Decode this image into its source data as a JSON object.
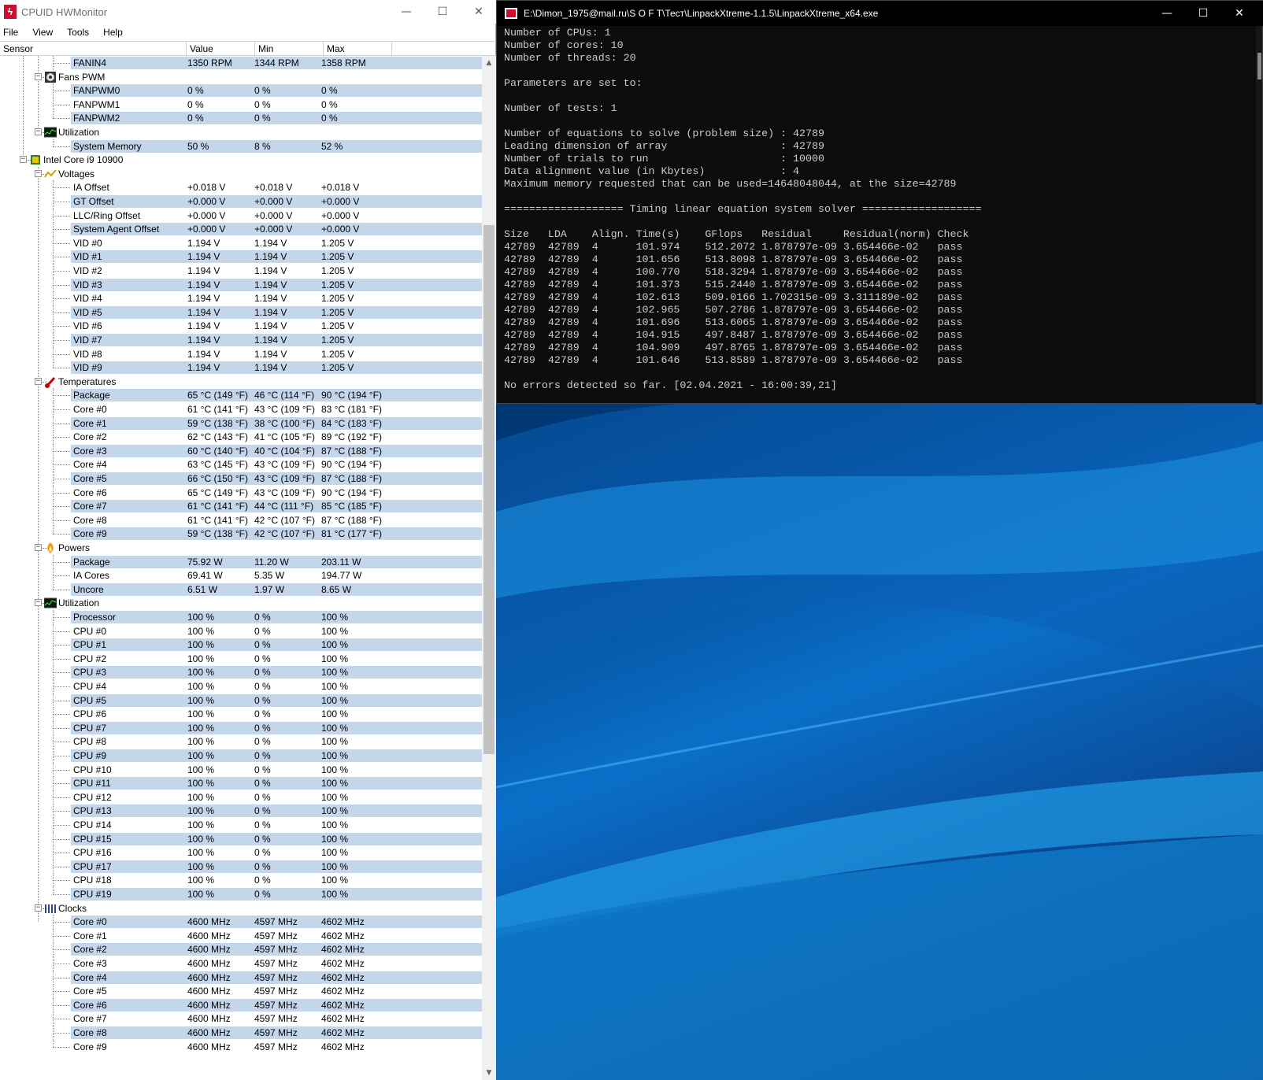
{
  "hwmonitor": {
    "title": "CPUID HWMonitor",
    "menu": [
      "File",
      "View",
      "Tools",
      "Help"
    ],
    "columns": [
      "Sensor",
      "Value",
      "Min",
      "Max"
    ],
    "rows": [
      {
        "label": "FANIN4",
        "value": "1350 RPM",
        "min": "1344 RPM",
        "max": "1358 RPM",
        "level": 3,
        "kind": "leaf"
      },
      {
        "label": "Fans PWM",
        "level": 2,
        "kind": "group",
        "icon": "fan-icon"
      },
      {
        "label": "FANPWM0",
        "value": "0 %",
        "min": "0 %",
        "max": "0 %",
        "level": 3,
        "kind": "leaf"
      },
      {
        "label": "FANPWM1",
        "value": "0 %",
        "min": "0 %",
        "max": "0 %",
        "level": 3,
        "kind": "leaf"
      },
      {
        "label": "FANPWM2",
        "value": "0 %",
        "min": "0 %",
        "max": "0 %",
        "level": 3,
        "kind": "leaf",
        "last": true
      },
      {
        "label": "Utilization",
        "level": 2,
        "kind": "group",
        "icon": "utilization-icon",
        "last": true
      },
      {
        "label": "System Memory",
        "value": "50 %",
        "min": "8 %",
        "max": "52 %",
        "level": 3,
        "kind": "leaf",
        "last": true
      },
      {
        "label": "Intel Core i9 10900",
        "level": 1,
        "kind": "group",
        "icon": "cpu-chip-icon"
      },
      {
        "label": "Voltages",
        "level": 2,
        "kind": "group",
        "icon": "voltage-icon"
      },
      {
        "label": "IA Offset",
        "value": "+0.018 V",
        "min": "+0.018 V",
        "max": "+0.018 V",
        "level": 3,
        "kind": "leaf"
      },
      {
        "label": "GT Offset",
        "value": "+0.000 V",
        "min": "+0.000 V",
        "max": "+0.000 V",
        "level": 3,
        "kind": "leaf"
      },
      {
        "label": "LLC/Ring Offset",
        "value": "+0.000 V",
        "min": "+0.000 V",
        "max": "+0.000 V",
        "level": 3,
        "kind": "leaf"
      },
      {
        "label": "System Agent Offset",
        "value": "+0.000 V",
        "min": "+0.000 V",
        "max": "+0.000 V",
        "level": 3,
        "kind": "leaf"
      },
      {
        "label": "VID #0",
        "value": "1.194 V",
        "min": "1.194 V",
        "max": "1.205 V",
        "level": 3,
        "kind": "leaf"
      },
      {
        "label": "VID #1",
        "value": "1.194 V",
        "min": "1.194 V",
        "max": "1.205 V",
        "level": 3,
        "kind": "leaf"
      },
      {
        "label": "VID #2",
        "value": "1.194 V",
        "min": "1.194 V",
        "max": "1.205 V",
        "level": 3,
        "kind": "leaf"
      },
      {
        "label": "VID #3",
        "value": "1.194 V",
        "min": "1.194 V",
        "max": "1.205 V",
        "level": 3,
        "kind": "leaf"
      },
      {
        "label": "VID #4",
        "value": "1.194 V",
        "min": "1.194 V",
        "max": "1.205 V",
        "level": 3,
        "kind": "leaf"
      },
      {
        "label": "VID #5",
        "value": "1.194 V",
        "min": "1.194 V",
        "max": "1.205 V",
        "level": 3,
        "kind": "leaf"
      },
      {
        "label": "VID #6",
        "value": "1.194 V",
        "min": "1.194 V",
        "max": "1.205 V",
        "level": 3,
        "kind": "leaf"
      },
      {
        "label": "VID #7",
        "value": "1.194 V",
        "min": "1.194 V",
        "max": "1.205 V",
        "level": 3,
        "kind": "leaf"
      },
      {
        "label": "VID #8",
        "value": "1.194 V",
        "min": "1.194 V",
        "max": "1.205 V",
        "level": 3,
        "kind": "leaf"
      },
      {
        "label": "VID #9",
        "value": "1.194 V",
        "min": "1.194 V",
        "max": "1.205 V",
        "level": 3,
        "kind": "leaf",
        "last": true
      },
      {
        "label": "Temperatures",
        "level": 2,
        "kind": "group",
        "icon": "thermometer-icon"
      },
      {
        "label": "Package",
        "value": "65 °C  (149 °F)",
        "min": "46 °C  (114 °F)",
        "max": "90 °C  (194 °F)",
        "level": 3,
        "kind": "leaf"
      },
      {
        "label": "Core #0",
        "value": "61 °C  (141 °F)",
        "min": "43 °C  (109 °F)",
        "max": "83 °C  (181 °F)",
        "level": 3,
        "kind": "leaf"
      },
      {
        "label": "Core #1",
        "value": "59 °C  (138 °F)",
        "min": "38 °C  (100 °F)",
        "max": "84 °C  (183 °F)",
        "level": 3,
        "kind": "leaf"
      },
      {
        "label": "Core #2",
        "value": "62 °C  (143 °F)",
        "min": "41 °C  (105 °F)",
        "max": "89 °C  (192 °F)",
        "level": 3,
        "kind": "leaf"
      },
      {
        "label": "Core #3",
        "value": "60 °C  (140 °F)",
        "min": "40 °C  (104 °F)",
        "max": "87 °C  (188 °F)",
        "level": 3,
        "kind": "leaf"
      },
      {
        "label": "Core #4",
        "value": "63 °C  (145 °F)",
        "min": "43 °C  (109 °F)",
        "max": "90 °C  (194 °F)",
        "level": 3,
        "kind": "leaf"
      },
      {
        "label": "Core #5",
        "value": "66 °C  (150 °F)",
        "min": "43 °C  (109 °F)",
        "max": "87 °C  (188 °F)",
        "level": 3,
        "kind": "leaf"
      },
      {
        "label": "Core #6",
        "value": "65 °C  (149 °F)",
        "min": "43 °C  (109 °F)",
        "max": "90 °C  (194 °F)",
        "level": 3,
        "kind": "leaf"
      },
      {
        "label": "Core #7",
        "value": "61 °C  (141 °F)",
        "min": "44 °C  (111 °F)",
        "max": "85 °C  (185 °F)",
        "level": 3,
        "kind": "leaf"
      },
      {
        "label": "Core #8",
        "value": "61 °C  (141 °F)",
        "min": "42 °C  (107 °F)",
        "max": "87 °C  (188 °F)",
        "level": 3,
        "kind": "leaf"
      },
      {
        "label": "Core #9",
        "value": "59 °C  (138 °F)",
        "min": "42 °C  (107 °F)",
        "max": "81 °C  (177 °F)",
        "level": 3,
        "kind": "leaf",
        "last": true
      },
      {
        "label": "Powers",
        "level": 2,
        "kind": "group",
        "icon": "power-icon"
      },
      {
        "label": "Package",
        "value": "75.92 W",
        "min": "11.20 W",
        "max": "203.11 W",
        "level": 3,
        "kind": "leaf"
      },
      {
        "label": "IA Cores",
        "value": "69.41 W",
        "min": "5.35 W",
        "max": "194.77 W",
        "level": 3,
        "kind": "leaf"
      },
      {
        "label": "Uncore",
        "value": "6.51 W",
        "min": "1.97 W",
        "max": "8.65 W",
        "level": 3,
        "kind": "leaf",
        "last": true
      },
      {
        "label": "Utilization",
        "level": 2,
        "kind": "group",
        "icon": "utilization-icon"
      },
      {
        "label": "Processor",
        "value": "100 %",
        "min": "0 %",
        "max": "100 %",
        "level": 3,
        "kind": "leaf"
      },
      {
        "label": "CPU #0",
        "value": "100 %",
        "min": "0 %",
        "max": "100 %",
        "level": 3,
        "kind": "leaf"
      },
      {
        "label": "CPU #1",
        "value": "100 %",
        "min": "0 %",
        "max": "100 %",
        "level": 3,
        "kind": "leaf"
      },
      {
        "label": "CPU #2",
        "value": "100 %",
        "min": "0 %",
        "max": "100 %",
        "level": 3,
        "kind": "leaf"
      },
      {
        "label": "CPU #3",
        "value": "100 %",
        "min": "0 %",
        "max": "100 %",
        "level": 3,
        "kind": "leaf"
      },
      {
        "label": "CPU #4",
        "value": "100 %",
        "min": "0 %",
        "max": "100 %",
        "level": 3,
        "kind": "leaf"
      },
      {
        "label": "CPU #5",
        "value": "100 %",
        "min": "0 %",
        "max": "100 %",
        "level": 3,
        "kind": "leaf"
      },
      {
        "label": "CPU #6",
        "value": "100 %",
        "min": "0 %",
        "max": "100 %",
        "level": 3,
        "kind": "leaf"
      },
      {
        "label": "CPU #7",
        "value": "100 %",
        "min": "0 %",
        "max": "100 %",
        "level": 3,
        "kind": "leaf"
      },
      {
        "label": "CPU #8",
        "value": "100 %",
        "min": "0 %",
        "max": "100 %",
        "level": 3,
        "kind": "leaf"
      },
      {
        "label": "CPU #9",
        "value": "100 %",
        "min": "0 %",
        "max": "100 %",
        "level": 3,
        "kind": "leaf"
      },
      {
        "label": "CPU #10",
        "value": "100 %",
        "min": "0 %",
        "max": "100 %",
        "level": 3,
        "kind": "leaf"
      },
      {
        "label": "CPU #11",
        "value": "100 %",
        "min": "0 %",
        "max": "100 %",
        "level": 3,
        "kind": "leaf"
      },
      {
        "label": "CPU #12",
        "value": "100 %",
        "min": "0 %",
        "max": "100 %",
        "level": 3,
        "kind": "leaf"
      },
      {
        "label": "CPU #13",
        "value": "100 %",
        "min": "0 %",
        "max": "100 %",
        "level": 3,
        "kind": "leaf"
      },
      {
        "label": "CPU #14",
        "value": "100 %",
        "min": "0 %",
        "max": "100 %",
        "level": 3,
        "kind": "leaf"
      },
      {
        "label": "CPU #15",
        "value": "100 %",
        "min": "0 %",
        "max": "100 %",
        "level": 3,
        "kind": "leaf"
      },
      {
        "label": "CPU #16",
        "value": "100 %",
        "min": "0 %",
        "max": "100 %",
        "level": 3,
        "kind": "leaf"
      },
      {
        "label": "CPU #17",
        "value": "100 %",
        "min": "0 %",
        "max": "100 %",
        "level": 3,
        "kind": "leaf"
      },
      {
        "label": "CPU #18",
        "value": "100 %",
        "min": "0 %",
        "max": "100 %",
        "level": 3,
        "kind": "leaf"
      },
      {
        "label": "CPU #19",
        "value": "100 %",
        "min": "0 %",
        "max": "100 %",
        "level": 3,
        "kind": "leaf",
        "last": true
      },
      {
        "label": "Clocks",
        "level": 2,
        "kind": "group",
        "icon": "clocks-icon",
        "last": true
      },
      {
        "label": "Core #0",
        "value": "4600 MHz",
        "min": "4597 MHz",
        "max": "4602 MHz",
        "level": 3,
        "kind": "leaf"
      },
      {
        "label": "Core #1",
        "value": "4600 MHz",
        "min": "4597 MHz",
        "max": "4602 MHz",
        "level": 3,
        "kind": "leaf"
      },
      {
        "label": "Core #2",
        "value": "4600 MHz",
        "min": "4597 MHz",
        "max": "4602 MHz",
        "level": 3,
        "kind": "leaf"
      },
      {
        "label": "Core #3",
        "value": "4600 MHz",
        "min": "4597 MHz",
        "max": "4602 MHz",
        "level": 3,
        "kind": "leaf"
      },
      {
        "label": "Core #4",
        "value": "4600 MHz",
        "min": "4597 MHz",
        "max": "4602 MHz",
        "level": 3,
        "kind": "leaf"
      },
      {
        "label": "Core #5",
        "value": "4600 MHz",
        "min": "4597 MHz",
        "max": "4602 MHz",
        "level": 3,
        "kind": "leaf"
      },
      {
        "label": "Core #6",
        "value": "4600 MHz",
        "min": "4597 MHz",
        "max": "4602 MHz",
        "level": 3,
        "kind": "leaf"
      },
      {
        "label": "Core #7",
        "value": "4600 MHz",
        "min": "4597 MHz",
        "max": "4602 MHz",
        "level": 3,
        "kind": "leaf"
      },
      {
        "label": "Core #8",
        "value": "4600 MHz",
        "min": "4597 MHz",
        "max": "4602 MHz",
        "level": 3,
        "kind": "leaf"
      },
      {
        "label": "Core #9",
        "value": "4600 MHz",
        "min": "4597 MHz",
        "max": "4602 MHz",
        "level": 3,
        "kind": "leaf",
        "last": true
      }
    ]
  },
  "console": {
    "title": "E:\\Dimon_1975@mail.ru\\S O F T\\Тест\\LinpackXtreme-1.1.5\\LinpackXtreme_x64.exe",
    "lines": [
      "Number of CPUs: 1",
      "Number of cores: 10",
      "Number of threads: 20",
      "",
      "Parameters are set to:",
      "",
      "Number of tests: 1",
      "",
      "Number of equations to solve (problem size) : 42789",
      "Leading dimension of array                  : 42789",
      "Number of trials to run                     : 10000",
      "Data alignment value (in Kbytes)            : 4",
      "Maximum memory requested that can be used=14648048044, at the size=42789",
      "",
      "=================== Timing linear equation system solver ===================",
      "",
      "Size   LDA    Align. Time(s)    GFlops   Residual     Residual(norm) Check",
      "42789  42789  4      101.974    512.2072 1.878797e-09 3.654466e-02   pass",
      "42789  42789  4      101.656    513.8098 1.878797e-09 3.654466e-02   pass",
      "42789  42789  4      100.770    518.3294 1.878797e-09 3.654466e-02   pass",
      "42789  42789  4      101.373    515.2440 1.878797e-09 3.654466e-02   pass",
      "42789  42789  4      102.613    509.0166 1.702315e-09 3.311189e-02   pass",
      "42789  42789  4      102.965    507.2786 1.878797e-09 3.654466e-02   pass",
      "42789  42789  4      101.696    513.6065 1.878797e-09 3.654466e-02   pass",
      "42789  42789  4      104.915    497.8487 1.878797e-09 3.654466e-02   pass",
      "42789  42789  4      104.909    497.8765 1.878797e-09 3.654466e-02   pass",
      "42789  42789  4      101.646    513.8589 1.878797e-09 3.654466e-02   pass",
      "",
      "No errors detected so far. [02.04.2021 - 16:00:39,21]"
    ]
  }
}
